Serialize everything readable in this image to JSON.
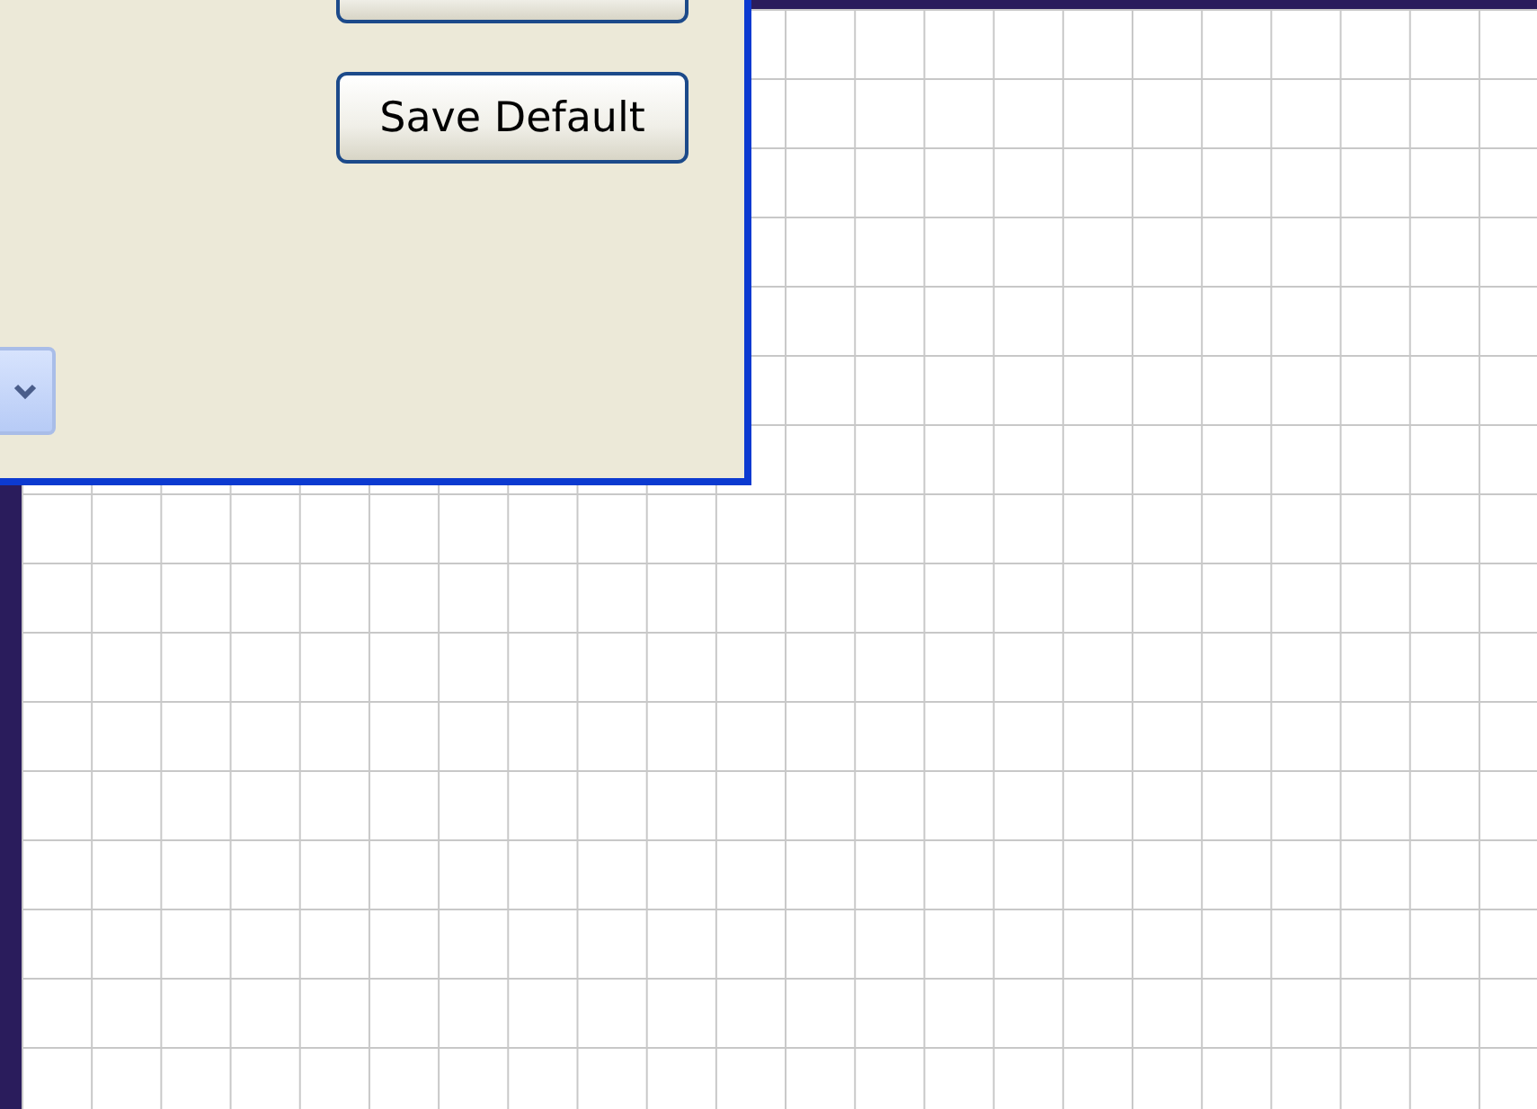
{
  "dialog": {
    "buttons": [
      {
        "label": "Save Default"
      }
    ]
  }
}
